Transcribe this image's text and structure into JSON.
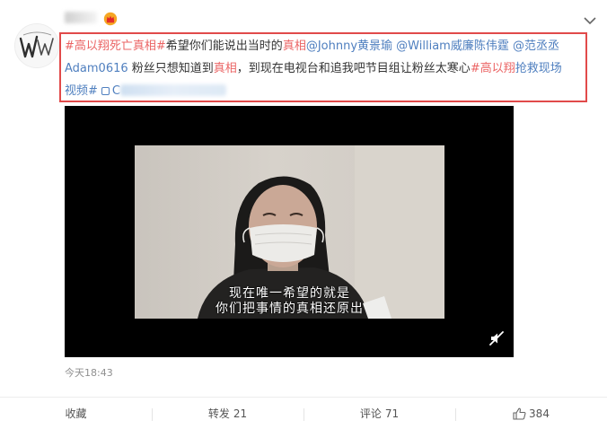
{
  "post": {
    "segments": [
      [
        {
          "type": "hashtag",
          "text": "#高以翔死亡真相#"
        },
        {
          "type": "plain",
          "text": "希望你们能说出当时的"
        },
        {
          "type": "hashtag",
          "text": "真相"
        },
        {
          "type": "mention",
          "text": "@Johnny黄景瑜"
        },
        {
          "type": "plain",
          "text": " "
        },
        {
          "type": "mention",
          "text": "@William威廉陈伟霆"
        },
        {
          "type": "plain",
          "text": " "
        },
        {
          "type": "mention",
          "text": "@范丞丞"
        }
      ],
      [
        {
          "type": "mention",
          "text": "Adam0616"
        },
        {
          "type": "plain",
          "text": " 粉丝只想知道到"
        },
        {
          "type": "hashtag",
          "text": "真相"
        },
        {
          "type": "plain",
          "text": "，到现在电视台和追我吧节目组让粉丝太寒心"
        },
        {
          "type": "hashtag",
          "text": "#高以翔"
        },
        {
          "type": "mention",
          "text": "抢救现场"
        }
      ]
    ],
    "line3_prefix": "视频#",
    "line3_link_letter": "C"
  },
  "video": {
    "subtitle_line1": "现在唯一希望的就是",
    "subtitle_line2": "你们把事情的真相还原出"
  },
  "timestamp": "今天18:43",
  "actions": {
    "favorite_label": "收藏",
    "repost_label": "转发",
    "repost_count": "21",
    "comment_label": "评论",
    "comment_count": "71",
    "like_count": "384"
  },
  "icons": {
    "avatar": "avatar-image",
    "badge": "vip-crown-icon",
    "collapse": "chevron-down-icon",
    "link": "link-icon",
    "mute": "mute-icon",
    "like": "thumbs-up-icon"
  },
  "colors": {
    "hashtag": "#eb6464",
    "mention": "#4f7fbf",
    "highlight_border": "#e14a4a"
  }
}
